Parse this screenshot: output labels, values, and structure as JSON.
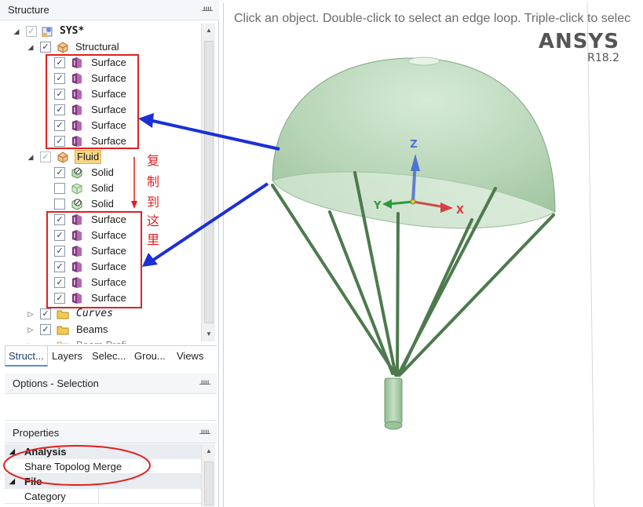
{
  "structure_panel": {
    "title": "Structure",
    "pin_icon": "pin-icon",
    "tree": {
      "root": "SYS*",
      "structural": {
        "label": "Structural",
        "surfaces": [
          "Surface",
          "Surface",
          "Surface",
          "Surface",
          "Surface",
          "Surface"
        ]
      },
      "fluid": {
        "label": "Fluid",
        "solids": [
          {
            "label": "Solid",
            "checked": true
          },
          {
            "label": "Solid",
            "checked": false
          },
          {
            "label": "Solid",
            "checked": false
          }
        ],
        "surfaces": [
          "Surface",
          "Surface",
          "Surface",
          "Surface",
          "Surface",
          "Surface"
        ]
      },
      "curves": "Curves",
      "beams": "Beams",
      "beam_profiles": "Beam Profi"
    }
  },
  "tabs": [
    "Struct...",
    "Layers",
    "Selec...",
    "Grou...",
    "Views"
  ],
  "options_panel": {
    "title": "Options - Selection"
  },
  "properties_panel": {
    "title": "Properties",
    "rows": [
      {
        "type": "category",
        "name": "Analysis"
      },
      {
        "type": "value",
        "name": "Share Topolog Merge"
      },
      {
        "type": "category",
        "name": "File"
      },
      {
        "type": "value",
        "name": "Category"
      }
    ]
  },
  "viewport": {
    "hint": "Click an object. Double-click to select an edge loop. Triple-click to selec",
    "brand": "ANSYS",
    "version": "R18.2",
    "axes": {
      "x": "X",
      "y": "Y",
      "z": "Z"
    }
  },
  "annotation": {
    "chars": [
      "复",
      "制",
      "到",
      "这",
      "里"
    ],
    "color": "#e02020",
    "arrow_color": "#1a2fd6"
  },
  "colors": {
    "canopy": "#bcd8bc",
    "lines": "#4d7a4d",
    "accent": "#5b8ec9"
  }
}
